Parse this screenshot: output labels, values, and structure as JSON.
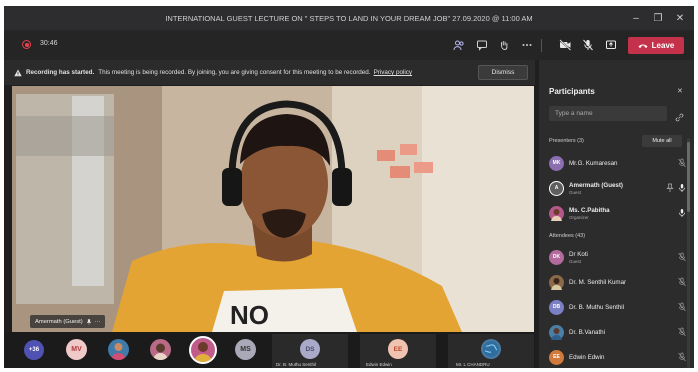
{
  "window": {
    "title": "INTERNATIONAL GUEST LECTURE ON \" STEPS TO LAND IN YOUR DREAM JOB\" 27.09.2020 @ 11:00 AM",
    "minimize": "–",
    "maximize": "❐",
    "close": "✕"
  },
  "toolbar": {
    "timer": "30:46",
    "leave_label": "Leave"
  },
  "banner": {
    "bold": "Recording has started.",
    "text": "This meeting is being recorded. By joining, you are giving consent for this meeting to be recorded.",
    "link": "Privacy policy",
    "dismiss": "Dismiss"
  },
  "video": {
    "name_tag": "Amermath (Guest)",
    "more": "···"
  },
  "strip": {
    "overflow": "+36",
    "tiles": [
      "MV",
      "MS",
      "DS",
      "EE"
    ],
    "labels": [
      "Dr. B. Muthu Senthil",
      "Edwin Edwin",
      "Mr. L CHANDRU"
    ]
  },
  "panel": {
    "title": "Participants",
    "close": "✕",
    "search_placeholder": "Type a name",
    "presenters_label": "Presenters (3)",
    "mute_all": "Mute all",
    "attendees_label": "Attendees (43)",
    "presenters": [
      {
        "name": "Mr.G. Kumaresan",
        "sub": "",
        "initials": "MK",
        "color": "#8b6fb0"
      },
      {
        "name": "Amermath (Guest)",
        "sub": "Guest",
        "initials": "A",
        "color": "#5f5f5f"
      },
      {
        "name": "Ms. C.Pabitha",
        "sub": "Organizer",
        "initials": "",
        "color": "#b5578a"
      }
    ],
    "attendees": [
      {
        "name": "Dr Koti",
        "sub": "Guest",
        "initials": "DK",
        "color": "#b36a9c"
      },
      {
        "name": "Dr. M. Senthil Kumar",
        "sub": "",
        "initials": "",
        "color": "#8a6a4a"
      },
      {
        "name": "Dr. B. Muthu Senthil",
        "sub": "",
        "initials": "DB",
        "color": "#7b7fc4"
      },
      {
        "name": "Dr. B.Vanathi",
        "sub": "",
        "initials": "",
        "color": "#4a7fa8"
      },
      {
        "name": "Edwin Edwin",
        "sub": "",
        "initials": "EE",
        "color": "#d07a3c"
      }
    ]
  },
  "colors": {
    "accent": "#6264a7",
    "leave": "#c4314b",
    "recording": "#e8414f"
  }
}
